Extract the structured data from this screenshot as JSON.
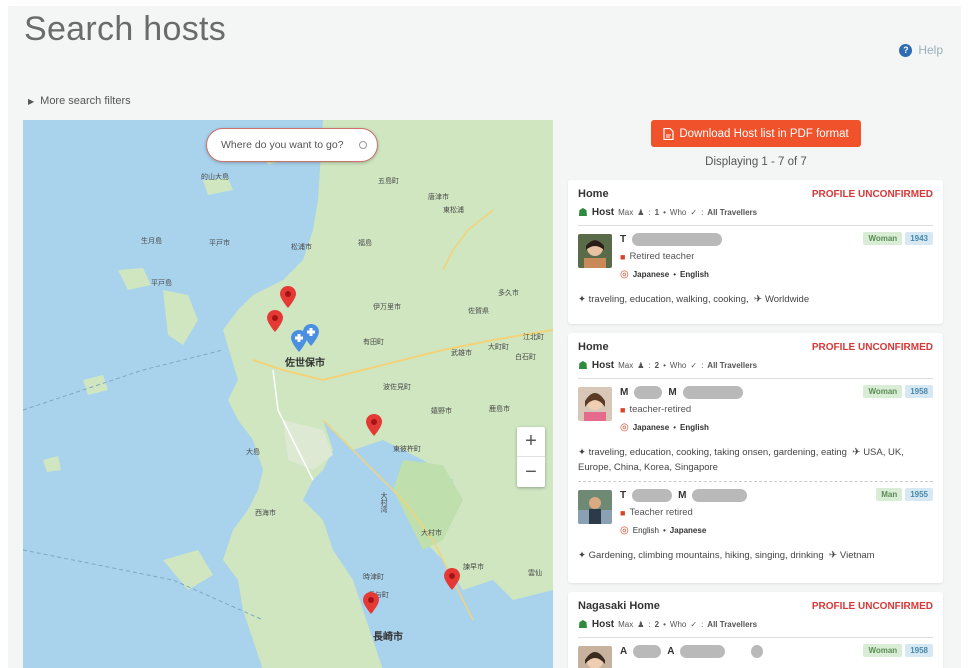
{
  "page": {
    "title": "Search hosts",
    "help_label": "Help",
    "more_filters_label": "More search filters"
  },
  "map": {
    "search_placeholder": "Where do you want to go?",
    "zoom_in_label": "+",
    "zoom_out_label": "−",
    "labels": [
      "的山大島",
      "五島町",
      "唐津市",
      "東松浦",
      "生月島",
      "平戸市",
      "松浦市",
      "福島",
      "平戸島",
      "伊万里市",
      "多久市",
      "佐賀県",
      "有田町",
      "江北町",
      "武雄市",
      "大町町",
      "白石町",
      "佐世保市",
      "波佐見町",
      "嬉野市",
      "鹿島市",
      "東彼杵町",
      "大島",
      "大村湾",
      "西海市",
      "大村市",
      "諫早市",
      "時津町",
      "長与町",
      "長崎市",
      "雲仙"
    ]
  },
  "results": {
    "download_label": "Download Host list in PDF format",
    "displaying": "Displaying 1 - 7 of 7"
  },
  "cards": [
    {
      "title": "Home",
      "status": "PROFILE UNCONFIRMED",
      "host_word": "Host",
      "max_label": "Max",
      "max_value": "1",
      "who_label": "Who",
      "who_value": "All Travellers",
      "people": [
        {
          "initial": "T",
          "gender": "Woman",
          "year": "1943",
          "occupation": "Retired teacher",
          "lang_primary": "Japanese",
          "lang_secondary": "English",
          "interests": "traveling, education, walking, cooking,",
          "destination": "Worldwide"
        }
      ]
    },
    {
      "title": "Home",
      "status": "PROFILE UNCONFIRMED",
      "host_word": "Host",
      "max_label": "Max",
      "max_value": "2",
      "who_label": "Who",
      "who_value": "All Travellers",
      "people": [
        {
          "initial": "M",
          "initial2": "M",
          "gender": "Woman",
          "year": "1958",
          "occupation": "teacher-retired",
          "lang_primary": "Japanese",
          "lang_secondary": "English",
          "interests": "traveling, education, cooking, taking onsen, gardening, eating",
          "destination": "USA, UK, Europe, China, Korea, Singapore"
        },
        {
          "initial": "T",
          "initial2": "M",
          "gender": "Man",
          "year": "1955",
          "occupation": "Teacher retired",
          "lang_primary": "English",
          "lang_secondary": "Japanese",
          "interests": "Gardening, climbing mountains, hiking, singing, drinking",
          "destination": "Vietnam"
        }
      ]
    },
    {
      "title": "Nagasaki Home",
      "status": "PROFILE UNCONFIRMED",
      "host_word": "Host",
      "max_label": "Max",
      "max_value": "2",
      "who_label": "Who",
      "who_value": "All Travellers",
      "people": [
        {
          "initial": "A",
          "initial2": "A",
          "gender": "Woman",
          "year": "1958"
        }
      ]
    }
  ],
  "colors": {
    "accent": "#f0522b",
    "unconfirmed": "#d73838",
    "host_green": "#2e8b3e",
    "map_water": "#a9d2ec",
    "map_land": "#cfe6c0"
  }
}
